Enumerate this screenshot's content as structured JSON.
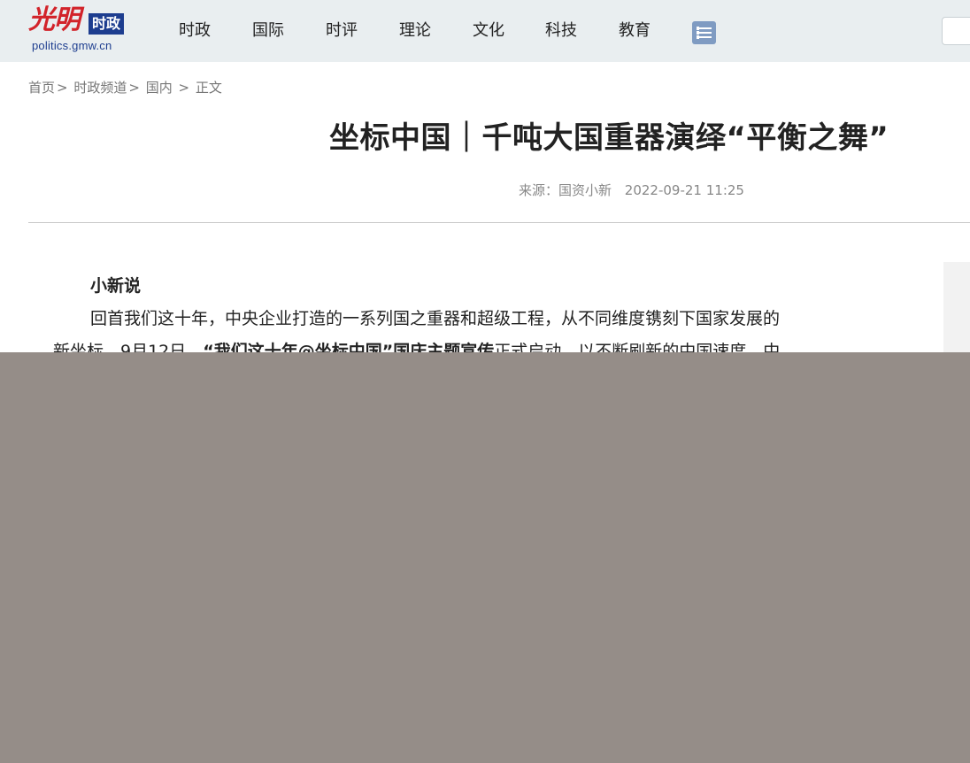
{
  "header": {
    "logo_brush": "光明",
    "logo_tag": "时政",
    "logo_url": "politics.gmw.cn",
    "nav": [
      "时政",
      "国际",
      "时评",
      "理论",
      "文化",
      "科技",
      "教育"
    ],
    "menu_icon": "list-menu-icon",
    "search_placeholder": ""
  },
  "breadcrumb": {
    "items": [
      "首页",
      "时政频道",
      "国内",
      "正文"
    ],
    "separators": [
      ">",
      ">",
      ">"
    ]
  },
  "article": {
    "title": "坐标中国｜千吨大国重器演绎“平衡之舞”",
    "source_label": "来源：国资小新",
    "date": "2022-09-21 11:25",
    "lead_heading": "小新说",
    "para1": "回首我们这十年，中央企业打造的一系列国之重器和超级工程，从不同维度镌刻下国家发展的",
    "para2_start": "新坐标。9月12日，",
    "para2_bold": "“我们这十年@坐标中国”国庆主题宣传",
    "para2_end": "正式启动，以不断刷新的中国速度、中"
  },
  "colors": {
    "header_bg": "#e9eef0",
    "logo_red": "#d2232a",
    "logo_blue": "#1d3d8f",
    "menu_button": "#7f9bc2",
    "overlay": "#958d88"
  }
}
